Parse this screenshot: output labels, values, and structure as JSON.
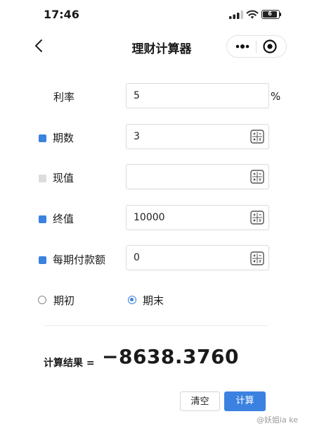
{
  "status_bar": {
    "time": "17:46",
    "battery": "6"
  },
  "nav": {
    "title": "理财计算器",
    "back_icon": "chevron-left-icon",
    "more_icon": "more-dots-icon",
    "target_icon": "target-icon"
  },
  "form": {
    "rate": {
      "label": "利率",
      "value": "5",
      "unit": "%"
    },
    "periods": {
      "label": "期数",
      "value": "3",
      "checked": true
    },
    "present_value": {
      "label": "现值",
      "value": "",
      "checked": false
    },
    "future_value": {
      "label": "终值",
      "value": "10000",
      "checked": true
    },
    "payment": {
      "label": "每期付款额",
      "value": "0",
      "checked": true
    },
    "timing": {
      "begin_label": "期初",
      "end_label": "期末",
      "selected": "end"
    }
  },
  "result": {
    "label": "计算结果 =",
    "value": "−8638.3760"
  },
  "buttons": {
    "clear": "清空",
    "calculate": "计算"
  },
  "watermark": "@妖姐ia ke",
  "colors": {
    "accent": "#3b82e0",
    "checkbox_off": "#dcdcdc",
    "border": "#dadada"
  }
}
